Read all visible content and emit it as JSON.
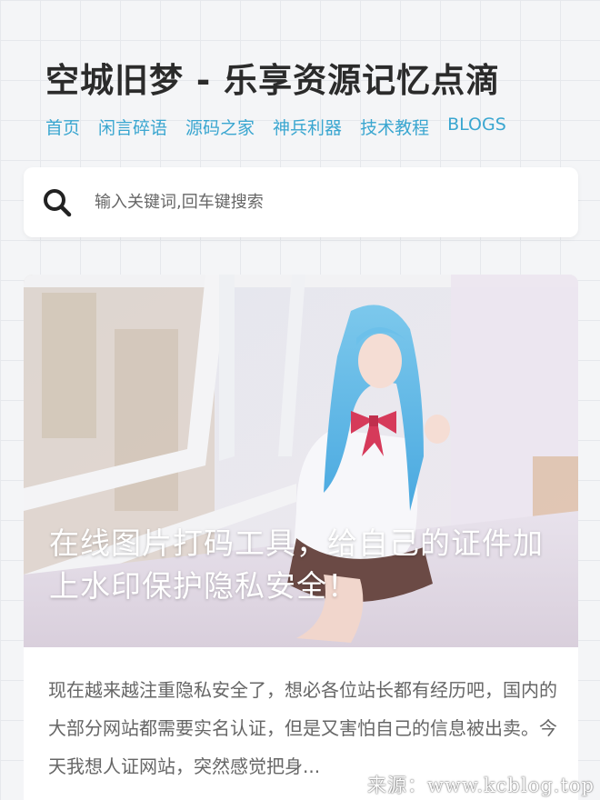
{
  "site": {
    "title": "空城旧梦 - 乐享资源记忆点滴"
  },
  "nav": {
    "items": [
      {
        "label": "首页"
      },
      {
        "label": "闲言碎语"
      },
      {
        "label": "源码之家"
      },
      {
        "label": "神兵利器"
      },
      {
        "label": "技术教程"
      },
      {
        "label": "BLOGS"
      }
    ]
  },
  "search": {
    "placeholder": "输入关键词,回车键搜索",
    "icon": "search-icon"
  },
  "post": {
    "title": "在线图片打码工具，给自己的证件加上水印保护隐私安全！",
    "excerpt": "现在越来越注重隐私安全了，想必各位站长都有经历吧，国内的大部分网站都需要实名认证，但是又害怕自己的信息被出卖。今天我想人证网站，突然感觉把身...",
    "image": "cosplay-girl-blue-hair-by-window"
  },
  "watermark": {
    "text": "来源：www.kcblog.top"
  },
  "colors": {
    "accent": "#3aa6d0",
    "title": "#2b2b2b",
    "background": "#f4f5f7"
  }
}
